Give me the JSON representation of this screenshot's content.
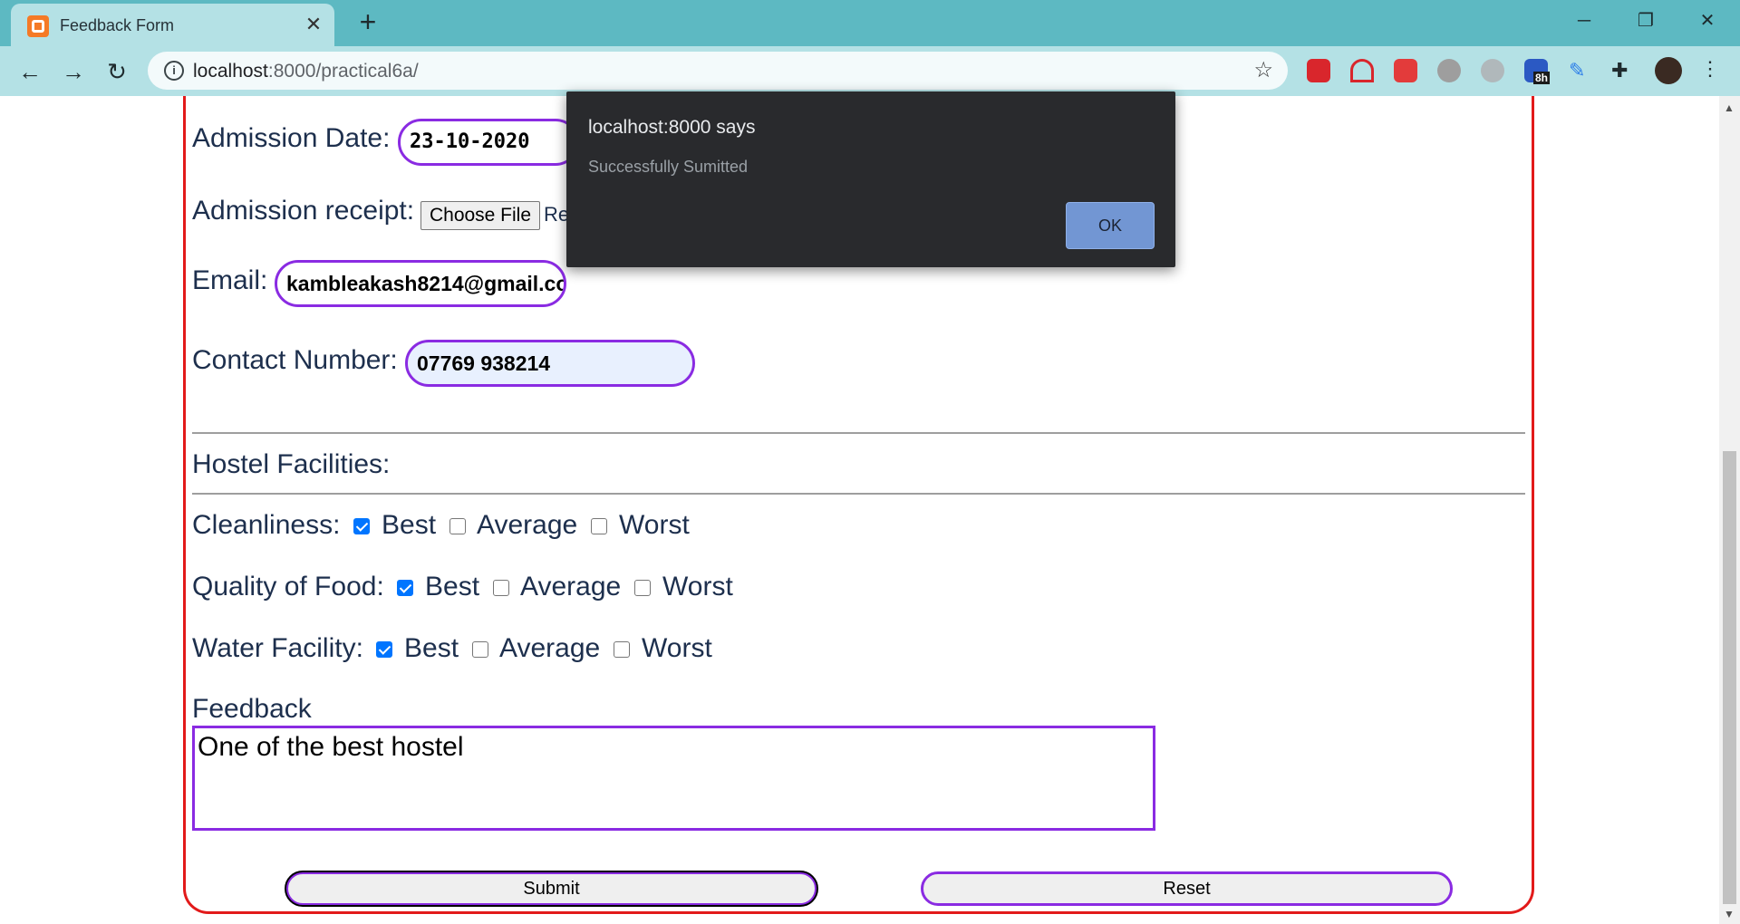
{
  "browser": {
    "tab_title": "Feedback Form",
    "tab_close": "✕",
    "new_tab": "+",
    "url_host": "localhost",
    "url_path": ":8000/practical6a/",
    "ext_badge": "8h"
  },
  "form": {
    "admission_date_label": "Admission Date:",
    "admission_date_value": "23-10-2020",
    "receipt_label": "Admission receipt:",
    "choose_file_label": "Choose File",
    "receipt_file_text": "Re",
    "email_label": "Email:",
    "email_value": "kambleakash8214@gmail.co",
    "contact_label": "Contact Number:",
    "contact_value": "07769 938214",
    "hostel_heading": "Hostel Facilities:",
    "rows": [
      {
        "label": "Cleanliness:",
        "options": [
          "Best",
          "Average",
          "Worst"
        ],
        "checked": [
          true,
          false,
          false
        ]
      },
      {
        "label": "Quality of Food:",
        "options": [
          "Best",
          "Average",
          "Worst"
        ],
        "checked": [
          true,
          false,
          false
        ]
      },
      {
        "label": "Water Facility:",
        "options": [
          "Best",
          "Average",
          "Worst"
        ],
        "checked": [
          true,
          false,
          false
        ]
      }
    ],
    "feedback_label": "Feedback",
    "feedback_value": "One of the best hostel",
    "submit_label": "Submit",
    "reset_label": "Reset"
  },
  "alert": {
    "title": "localhost:8000 says",
    "message": "Successfully Sumitted",
    "ok_label": "OK"
  },
  "colors": {
    "accent_border": "#8a2be2",
    "form_border": "#e21a1a",
    "checkbox_checked": "#0075ff"
  }
}
